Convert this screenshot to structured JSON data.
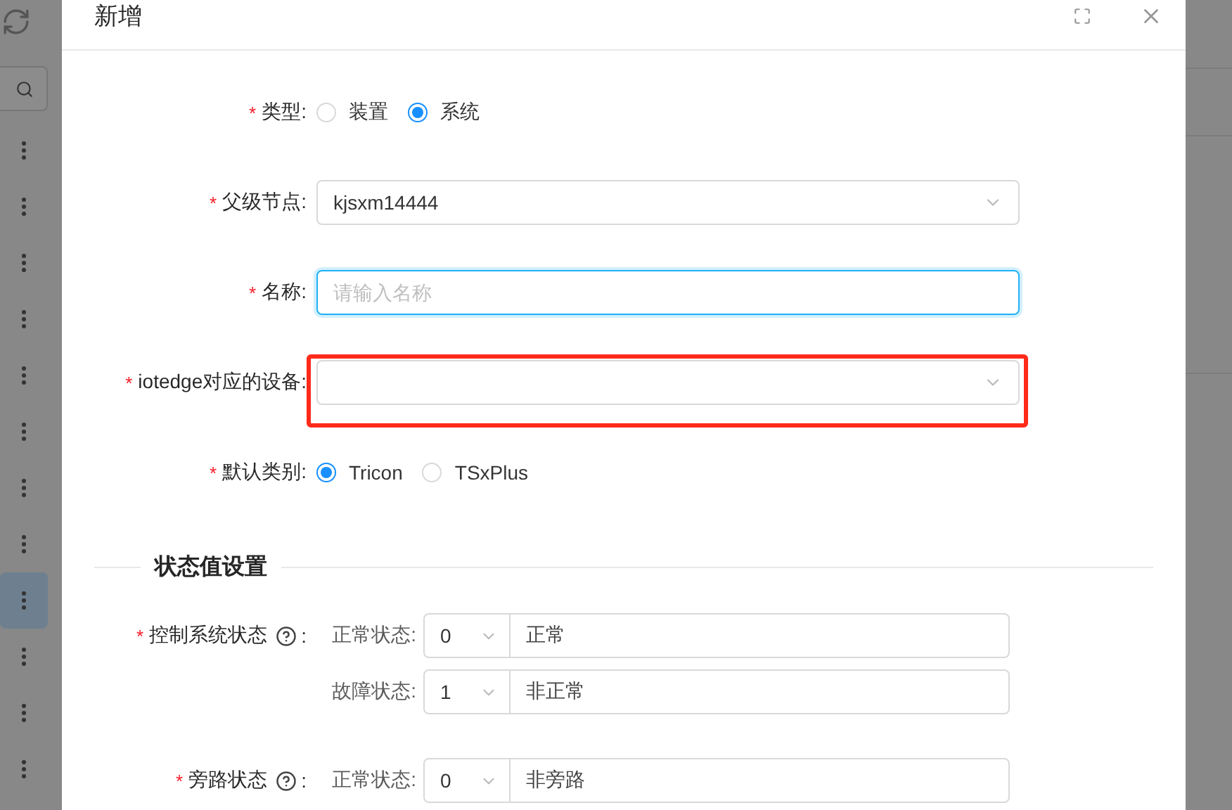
{
  "side_toolbar": {
    "row_menus": [
      {
        "selected": false
      },
      {
        "selected": false
      },
      {
        "selected": false
      },
      {
        "selected": false
      },
      {
        "selected": false
      },
      {
        "selected": false
      },
      {
        "selected": false
      },
      {
        "selected": false
      },
      {
        "selected": true
      },
      {
        "selected": false
      },
      {
        "selected": false
      },
      {
        "selected": false
      }
    ]
  },
  "dialog": {
    "title": "新增",
    "fields": [
      {
        "kind": "radio",
        "required_mark": "*",
        "label": "类型:",
        "options": [
          {
            "label": "装置",
            "selected": false
          },
          {
            "label": "系统",
            "selected": true
          }
        ]
      },
      {
        "kind": "select",
        "required_mark": "*",
        "label": "父级节点:",
        "value": "kjsxm14444"
      },
      {
        "kind": "input",
        "required_mark": "*",
        "label": "名称:",
        "placeholder": "请输入名称",
        "focused": true
      },
      {
        "kind": "select",
        "required_mark": "*",
        "label": "iotedge对应的设备:",
        "highlighted": true
      },
      {
        "kind": "radio",
        "required_mark": "*",
        "label": "默认类别:",
        "options": [
          {
            "label": "Tricon",
            "selected": true
          },
          {
            "label": "TSxPlus",
            "selected": false
          }
        ]
      }
    ],
    "section_title": "状态值设置",
    "status_groups": [
      {
        "required_mark": "*",
        "label": "控制系统状态",
        "help": true,
        "colon": ":",
        "rows": [
          {
            "label": "正常状态:",
            "code": "0",
            "text": "正常"
          },
          {
            "label": "故障状态:",
            "code": "1",
            "text": "非正常"
          }
        ]
      },
      {
        "required_mark": "*",
        "label": "旁路状态",
        "help": true,
        "colon": ":",
        "rows": [
          {
            "label": "正常状态:",
            "code": "0",
            "text": "非旁路"
          }
        ]
      }
    ]
  }
}
